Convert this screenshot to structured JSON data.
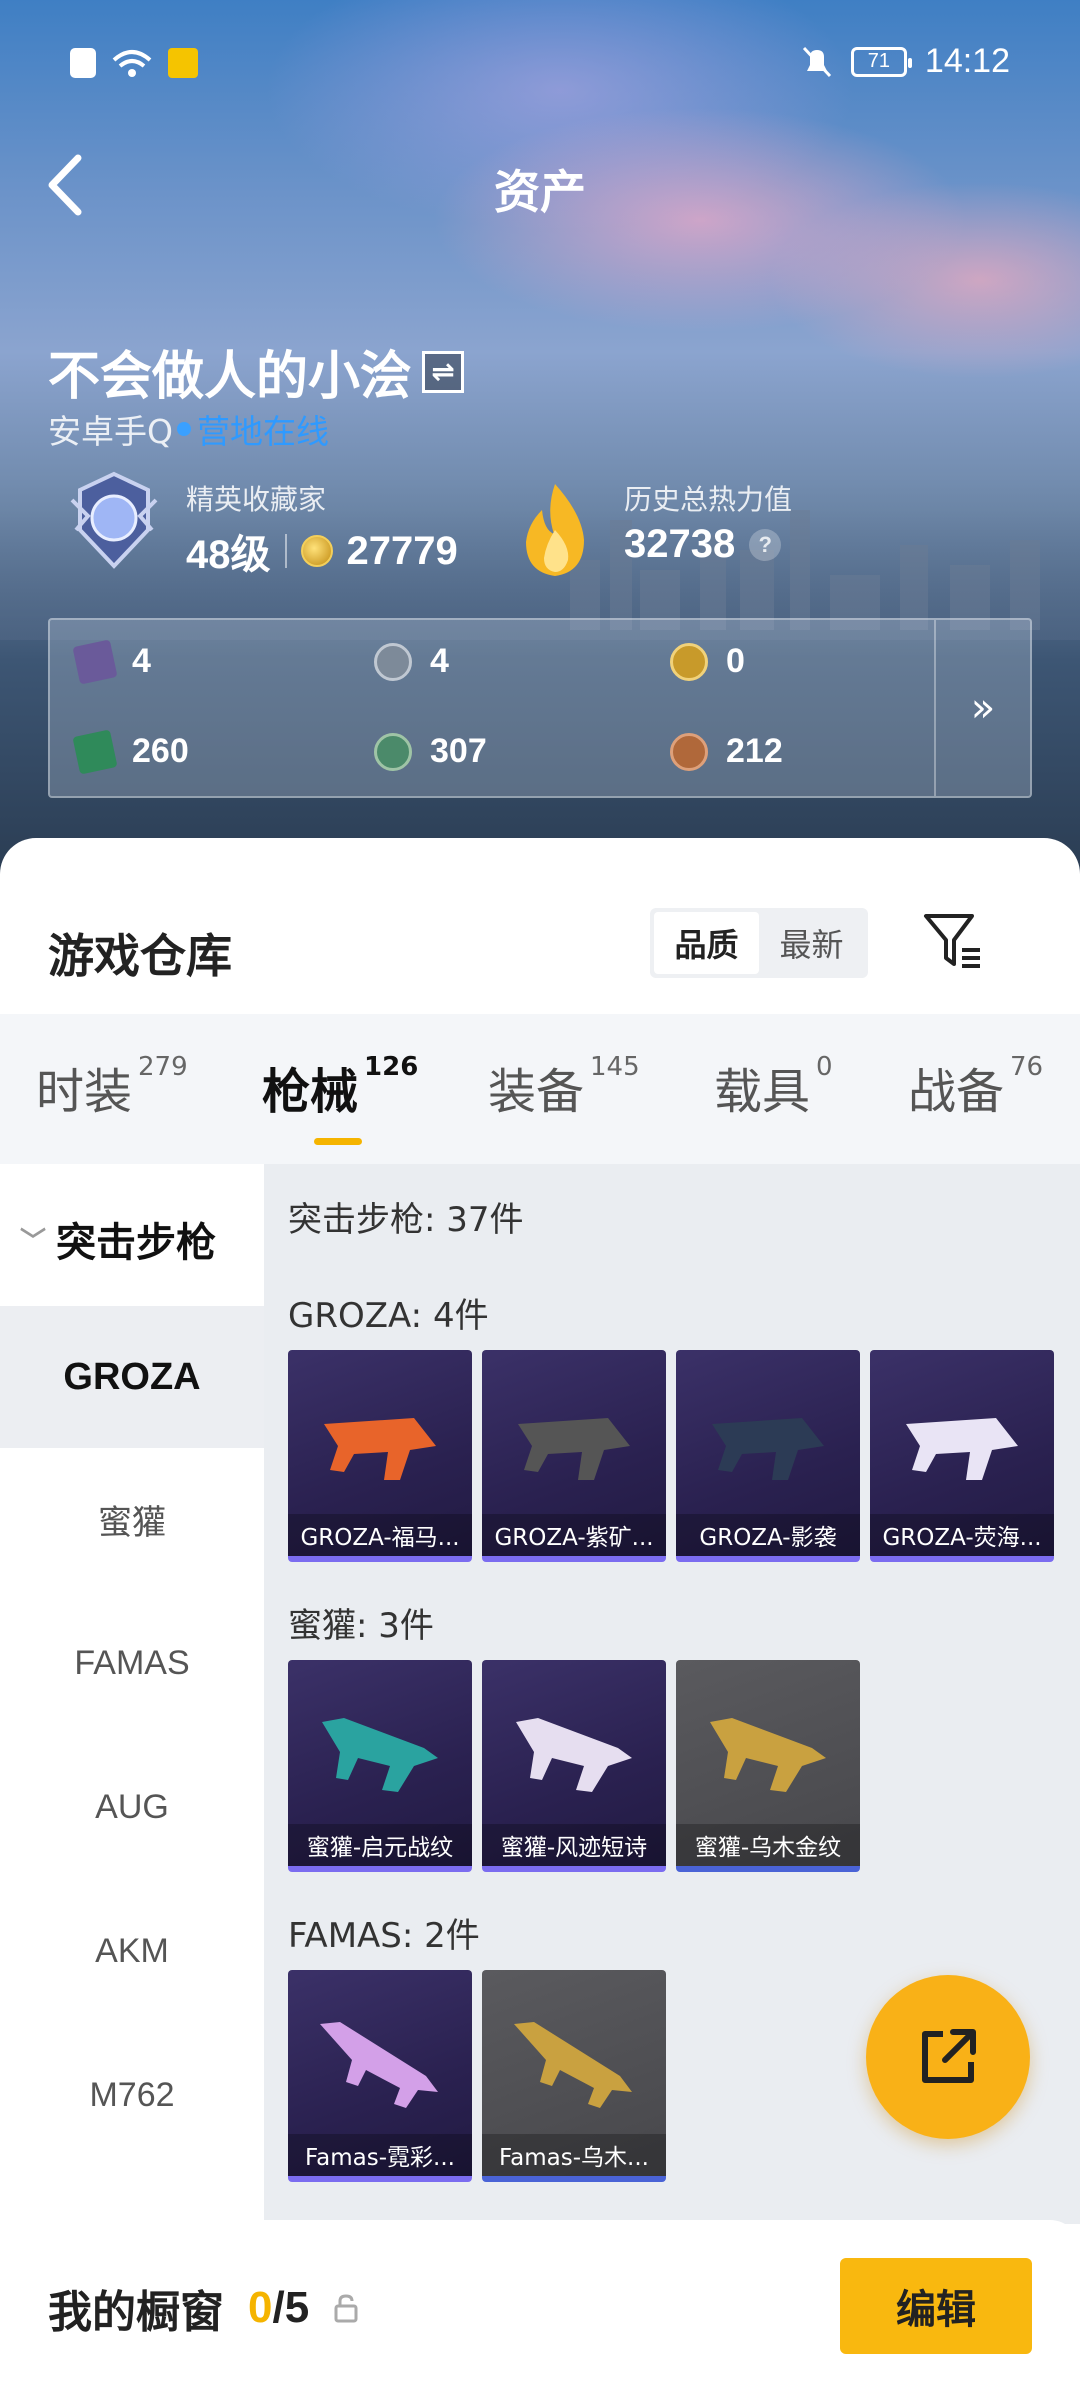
{
  "status_bar": {
    "time": "14:12",
    "battery": "71"
  },
  "header": {
    "title": "资产"
  },
  "profile": {
    "username": "不会做人的小浍",
    "platform": "安卓手Q",
    "online_status": "营地在线",
    "collector_label": "精英收藏家",
    "level": "48级",
    "coins": "27779",
    "heat_label": "历史总热力值",
    "heat_value": "32738",
    "help_mark": "?"
  },
  "resources": [
    {
      "value": "4",
      "icon": "card-icon",
      "color": "#6a5a9a"
    },
    {
      "value": "4",
      "icon": "silver-medal-icon",
      "color": "#7d8a99"
    },
    {
      "value": "0",
      "icon": "gold-medal-icon",
      "color": "#c89a2a"
    },
    {
      "value": "260",
      "icon": "green-card-icon",
      "color": "#2f8a5a"
    },
    {
      "value": "307",
      "icon": "green-orb-icon",
      "color": "#4b8a6a"
    },
    {
      "value": "212",
      "icon": "bronze-orb-icon",
      "color": "#b0683a"
    }
  ],
  "warehouse": {
    "title": "游戏仓库",
    "sort_options": [
      "品质",
      "最新"
    ],
    "tabs": [
      {
        "label": "时装",
        "count": "279"
      },
      {
        "label": "枪械",
        "count": "126"
      },
      {
        "label": "装备",
        "count": "145"
      },
      {
        "label": "载具",
        "count": "0"
      },
      {
        "label": "战备",
        "count": "76"
      }
    ],
    "category": "突击步枪",
    "sub_nav": [
      "GROZA",
      "蜜獾",
      "FAMAS",
      "AUG",
      "AKM",
      "M762"
    ],
    "category_count": "突击步枪: 37件",
    "groups": [
      {
        "label": "GROZA: 4件",
        "items": [
          {
            "name": "GROZA-福马...",
            "style": "purple",
            "gun": "#e8642a"
          },
          {
            "name": "GROZA-紫矿...",
            "style": "purple",
            "gun": "#555"
          },
          {
            "name": "GROZA-影袭",
            "style": "purple",
            "gun": "#2c3b55"
          },
          {
            "name": "GROZA-荧海...",
            "style": "purple",
            "gun": "#e9e4f5"
          }
        ]
      },
      {
        "label": "蜜獾: 3件",
        "items": [
          {
            "name": "蜜獾-启元战纹",
            "style": "purple",
            "gun": "#2aa3a0"
          },
          {
            "name": "蜜獾-风迹短诗",
            "style": "purple",
            "gun": "#e6def0"
          },
          {
            "name": "蜜獾-乌木金纹",
            "style": "gray",
            "gun": "#c9a140"
          }
        ]
      },
      {
        "label": "FAMAS: 2件",
        "items": [
          {
            "name": "Famas-霓彩...",
            "style": "purple",
            "gun": "#d3a0e8"
          },
          {
            "name": "Famas-乌木...",
            "style": "gray",
            "gun": "#c9a140"
          }
        ]
      }
    ]
  },
  "showcase": {
    "title": "我的橱窗",
    "current": "0",
    "total": "/5",
    "edit_label": "编辑"
  },
  "colors": {
    "accent": "#f5b400",
    "online": "#2f9aff"
  }
}
